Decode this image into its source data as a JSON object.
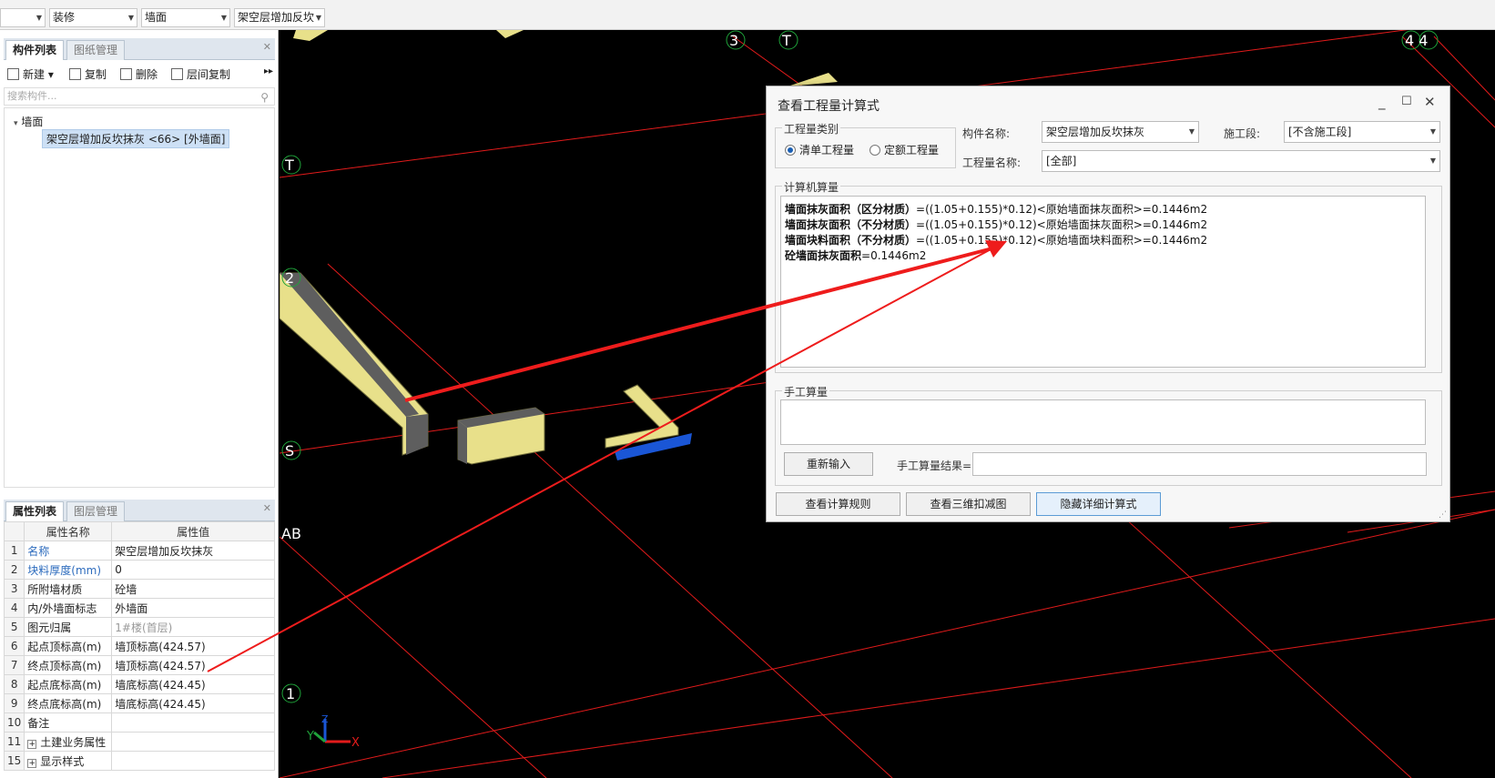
{
  "topbar": {
    "selects": [
      "",
      "装修",
      "墙面",
      "架空层增加反坎"
    ]
  },
  "left_top": {
    "tabs": [
      "构件列表",
      "图纸管理"
    ],
    "toolbar": {
      "new": "新建",
      "copy": "复制",
      "delete": "删除",
      "floor_copy": "层间复制"
    },
    "search_placeholder": "搜索构件...",
    "tree": {
      "root": "墙面",
      "item": "架空层增加反坎抹灰 <66> [外墙面]"
    }
  },
  "left_bottom": {
    "tabs": [
      "属性列表",
      "图层管理"
    ],
    "headers": {
      "name": "属性名称",
      "value": "属性值"
    },
    "rows": [
      {
        "no": "1",
        "name": "名称",
        "value": "架空层增加反坎抹灰"
      },
      {
        "no": "2",
        "name": "块料厚度(mm)",
        "value": "0"
      },
      {
        "no": "3",
        "name": "所附墙材质",
        "value": "砼墙"
      },
      {
        "no": "4",
        "name": "内/外墙面标志",
        "value": "外墙面"
      },
      {
        "no": "5",
        "name": "图元归属",
        "value": "1#楼(首层)"
      },
      {
        "no": "6",
        "name": "起点顶标高(m)",
        "value": "墙顶标高(424.57)"
      },
      {
        "no": "7",
        "name": "终点顶标高(m)",
        "value": "墙顶标高(424.57)"
      },
      {
        "no": "8",
        "name": "起点底标高(m)",
        "value": "墙底标高(424.45)"
      },
      {
        "no": "9",
        "name": "终点底标高(m)",
        "value": "墙底标高(424.45)"
      },
      {
        "no": "10",
        "name": "备注",
        "value": ""
      },
      {
        "no": "11",
        "name": "土建业务属性",
        "value": ""
      },
      {
        "no": "15",
        "name": "显示样式",
        "value": ""
      }
    ]
  },
  "viewport": {
    "axes": {
      "a3": "3",
      "t_top": "T",
      "a44": "4 4",
      "t_left": "T",
      "s": "S",
      "ab": "AB",
      "one": "1",
      "two": "2"
    },
    "gizmo": {
      "x": "X",
      "y": "Y",
      "z": "Z"
    },
    "colors": {
      "grid": "#e31b1b",
      "wall": "#e8e08a",
      "dark": "#5e5e5e",
      "blue": "#1a56d6",
      "arrow": "#ee1c1c"
    }
  },
  "dialog": {
    "title": "查看工程量计算式",
    "type_group": "工程量类别",
    "radio1": "清单工程量",
    "radio2": "定额工程量",
    "comp_label": "构件名称:",
    "comp_value": "架空层增加反坎抹灰",
    "stage_label": "施工段:",
    "stage_value": "[不含施工段]",
    "qty_label": "工程量名称:",
    "qty_value": "[全部]",
    "calc_group": "计算机算量",
    "calc_lines": [
      {
        "bold": "墙面抹灰面积（区分材质）",
        "rest": "=((1.05+0.155)*0.12)<原始墙面抹灰面积>=0.1446m2"
      },
      {
        "bold": "墙面抹灰面积（不分材质）",
        "rest": "=((1.05+0.155)*0.12)<原始墙面抹灰面积>=0.1446m2"
      },
      {
        "bold": "墙面块料面积（不分材质）",
        "rest": "=((1.05+0.155)*0.12)<原始墙面块料面积>=0.1446m2"
      },
      {
        "bold": "砼墙面抹灰面积",
        "rest": "=0.1446m2"
      }
    ],
    "manual_group": "手工算量",
    "reenter": "重新输入",
    "manual_result_label": "手工算量结果=",
    "btn_rules": "查看计算规则",
    "btn_3d": "查看三维扣减图",
    "btn_hide": "隐藏详细计算式"
  }
}
